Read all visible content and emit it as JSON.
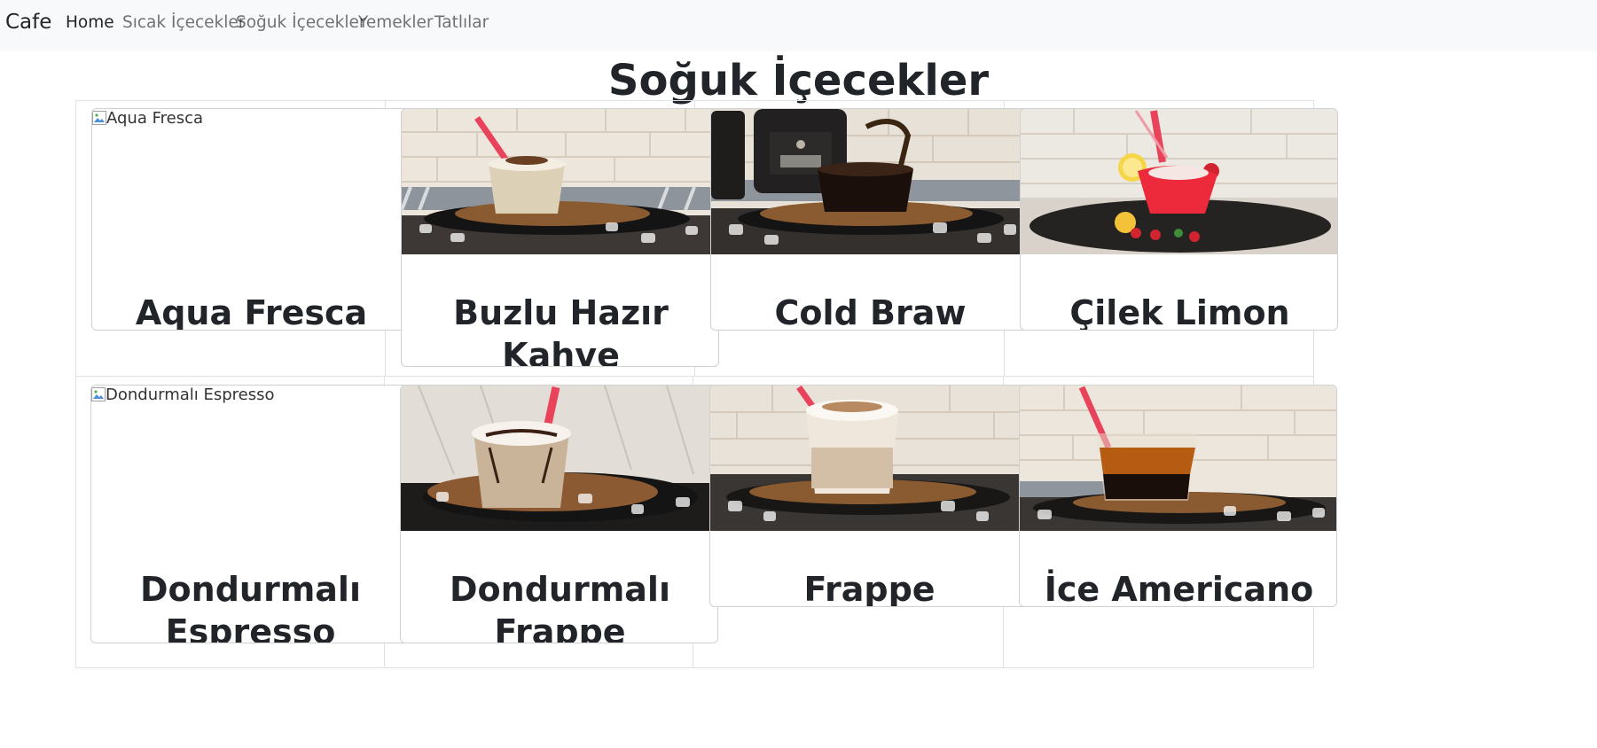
{
  "nav": {
    "brand": "Cafe",
    "items": [
      {
        "label": "Home",
        "active": true
      },
      {
        "label": "Sıcak İçecekler",
        "active": false
      },
      {
        "label": "Soğuk İçecekler",
        "active": false
      },
      {
        "label": "Yemekler",
        "active": false
      },
      {
        "label": "Tatlılar",
        "active": false
      }
    ]
  },
  "page": {
    "title": "Soğuk İçecekler"
  },
  "products": [
    {
      "name": "Aqua Fresca",
      "image_alt": "Aqua Fresca",
      "image_loaded": false
    },
    {
      "name": "Buzlu Hazır Kahve",
      "image_alt": "Buzlu Hazır Kahve",
      "image_loaded": true
    },
    {
      "name": "Cold Braw Kolalı",
      "image_alt": "Cold Braw Kolalı",
      "image_loaded": true
    },
    {
      "name": "Çilek Limon",
      "image_alt": "Çilek Limon",
      "image_loaded": true
    },
    {
      "name": "Dondurmalı Espresso",
      "image_alt": "Dondurmalı Espresso",
      "image_loaded": false
    },
    {
      "name": "Dondurmalı Frappe",
      "image_alt": "Dondurmalı Frappe",
      "image_loaded": true
    },
    {
      "name": "Frappe",
      "image_alt": "Frappe",
      "image_loaded": true
    },
    {
      "name": "İce Americano",
      "image_alt": "İce Americano",
      "image_loaded": true
    }
  ],
  "colors": {
    "navbar_bg": "#f8f9fa",
    "text": "#212529",
    "nav_muted": "#6c757d",
    "border": "#dee2e6"
  }
}
